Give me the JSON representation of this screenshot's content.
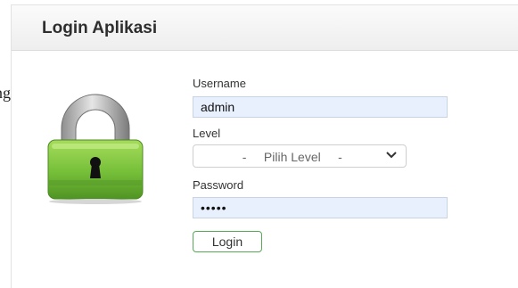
{
  "window": {
    "title": "Login Aplikasi"
  },
  "stray_text": "ng",
  "form": {
    "username": {
      "label": "Username",
      "value": "admin"
    },
    "level": {
      "label": "Level",
      "selected": "   -     Pilih Level     -"
    },
    "password": {
      "label": "Password",
      "value": "•••••"
    },
    "login_button": "Login"
  },
  "icons": {
    "lock": "padlock-icon",
    "dropdown": "chevron-down-icon"
  },
  "colors": {
    "lock_body": "#6bb33a",
    "lock_shackle": "#bdbdbd",
    "input_fill": "#e8f0fe",
    "button_border": "#58a858"
  }
}
